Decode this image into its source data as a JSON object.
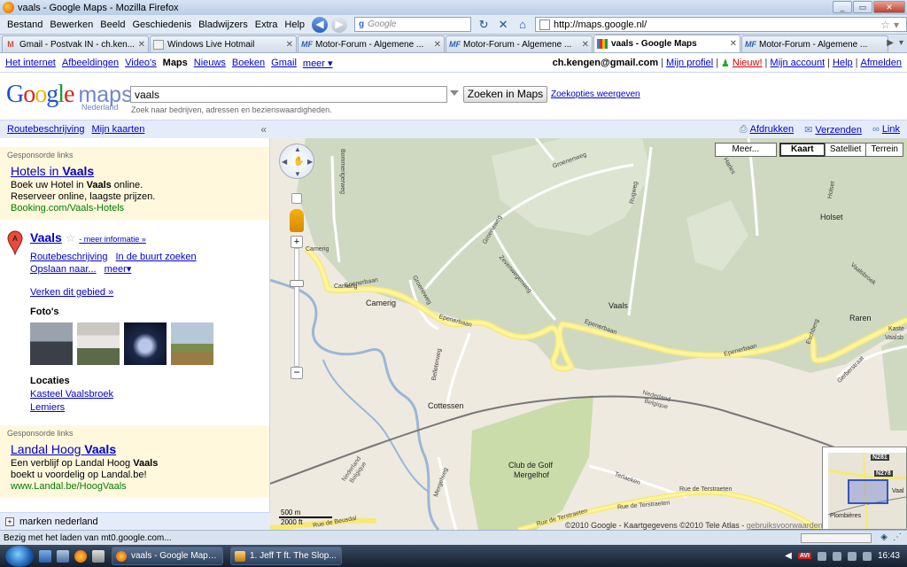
{
  "window": {
    "title": "vaals - Google Maps - Mozilla Firefox",
    "buttons": [
      "_",
      "▭",
      "✕"
    ]
  },
  "menu": [
    "Bestand",
    "Bewerken",
    "Beeld",
    "Geschiedenis",
    "Bladwijzers",
    "Extra",
    "Help"
  ],
  "toolbar": {
    "search_placeholder": "Google",
    "search_engine": "g",
    "back_glyph": "◀",
    "forward_glyph": "▶",
    "url": "http://maps.google.nl/"
  },
  "tabs": [
    {
      "label": "Gmail - Postvak IN - ch.ken...",
      "icon": "gmail-icon",
      "glyph": "M",
      "active": false
    },
    {
      "label": "Windows Live Hotmail",
      "icon": "hotmail-icon",
      "glyph": "",
      "active": false
    },
    {
      "label": "Motor-Forum - Algemene ...",
      "icon": "motorforum-icon",
      "glyph": "MF",
      "active": false
    },
    {
      "label": "Motor-Forum - Algemene ...",
      "icon": "motorforum-icon",
      "glyph": "MF",
      "active": false
    },
    {
      "label": "vaals - Google Maps",
      "icon": "google-maps-icon",
      "glyph": "",
      "active": true
    },
    {
      "label": "Motor-Forum - Algemene ...",
      "icon": "motorforum-icon",
      "glyph": "MF",
      "active": false
    }
  ],
  "gbar": {
    "left": [
      "Het internet",
      "Afbeeldingen",
      "Video's",
      "Maps",
      "Nieuws",
      "Boeken",
      "Gmail",
      "meer ▾"
    ],
    "current": "Maps",
    "email": "ch.kengen@gmail.com",
    "right": [
      "Mijn profiel",
      "Nieuw!",
      "Mijn account",
      "Help",
      "Afmelden"
    ]
  },
  "maps_header": {
    "logo_letters": [
      "G",
      "o",
      "o",
      "g",
      "l",
      "e"
    ],
    "logo_maps": "maps",
    "logo_sub": "Nederland",
    "query": "vaals",
    "search_button": "Zoeken in Maps",
    "options_link": "Zoekopties weergeven",
    "hint": "Zoek naar bedrijven, adressen en bezienswaardigheden."
  },
  "panel": {
    "links": [
      "Routebeschrijving",
      "Mijn kaarten"
    ],
    "collapse": "«",
    "ad1": {
      "heading": "Gesponsorde links",
      "title_pre": "Hotels in ",
      "title_bold": "Vaals",
      "line1_pre": "Boek uw Hotel in ",
      "line1_bold": "Vaals",
      "line1_post": " online.",
      "line2": "Reserveer online, laagste prijzen.",
      "url": "Booking.com/Vaals-Hotels"
    },
    "result": {
      "pin_letter": "A",
      "title": "Vaals",
      "star": "☆",
      "more": "- meer informatie »",
      "actions": [
        "Routebeschrijving",
        "In de buurt zoeken",
        "Opslaan naar...",
        "meer▾"
      ],
      "explore": "Verken dit gebied »",
      "photos_heading": "Foto's",
      "locations_heading": "Locaties",
      "locations": [
        "Kasteel Vaalsbroek",
        "Lemiers"
      ]
    },
    "ad2": {
      "heading": "Gesponsorde links",
      "title_pre": "Landal Hoog ",
      "title_bold": "Vaals",
      "line1_pre": "Een verblijf op Landal Hoog ",
      "line1_bold": "Vaals",
      "line2": "boekt u voordelig op Landal.be!",
      "url": "www.Landal.be/HoogVaals"
    },
    "bottom": {
      "plus": "+",
      "label": "marken nederland"
    }
  },
  "map": {
    "top_links": [
      "Afdrukken",
      "Verzenden",
      "Link"
    ],
    "top_icons": [
      "print-icon",
      "mail-icon",
      "link-icon"
    ],
    "types": {
      "more": "Meer...",
      "map": "Kaart",
      "satellite": "Satelliet",
      "terrain": "Terrein",
      "selected": "Kaart"
    },
    "zoom": {
      "plus": "+",
      "minus": "−"
    },
    "scale": {
      "metric": "500 m",
      "imperial": "2000 ft"
    },
    "copyright": "©2010 Google - Kaartgegevens ©2010 Tele Atlas - ",
    "terms": "gebruiksvoorwaarden",
    "labels": {
      "camerig1": "Camerig",
      "camerig2": "Camerig",
      "camerig3": "Camerig",
      "vaals": "Vaals",
      "cottessen": "Cottessen",
      "holset": "Holset",
      "raren": "Raren",
      "golf1": "Club de Golf",
      "golf2": "Mergelhof",
      "ep1": "Epenerbaan",
      "ep2": "Epenerbaan",
      "ep3": "Epenerbaan",
      "eschberg": "Eschberg",
      "groeneweg1": "Groeneweg",
      "groeneweg2": "Groeneweg",
      "groenenweg": "Groenenweg",
      "zevenwegen": "Zevenwegenweg",
      "rugweg": "Rugweg",
      "bommerig": "Bommerigerweg",
      "belleter": "Belleterweg",
      "mergelweg": "Mergelweg",
      "terstraeten1": "Rue de Terstraeten",
      "terstraeten2": "Rue de Terstraeten",
      "terstraeten3": "Rue de Terstraeten",
      "terlaeken": "Terlaeken",
      "kaste": "Kaste",
      "vaalsb": "Vaalsb",
      "harles": "Harles",
      "holset2": "Holset",
      "vaalsbroek": "Vaalsbroek",
      "gerberstraat": "Gerberstraat",
      "beusdal": "Rue de Beusdal",
      "nl1": "Nederland",
      "be1": "Belgique",
      "nl2": "Nederland",
      "be2": "Belgique"
    },
    "overview": {
      "shield1": "N281",
      "shield2": "N278",
      "plombieres": "Plombières",
      "vaal": "Vaal"
    }
  },
  "status": {
    "text": "Bezig met het laden van mt0.google.com..."
  },
  "taskbar": {
    "buttons": [
      "vaals - Google Maps...",
      "1. Jeff T ft. The Slop..."
    ],
    "avira": "AVI",
    "clock": "16:43"
  }
}
